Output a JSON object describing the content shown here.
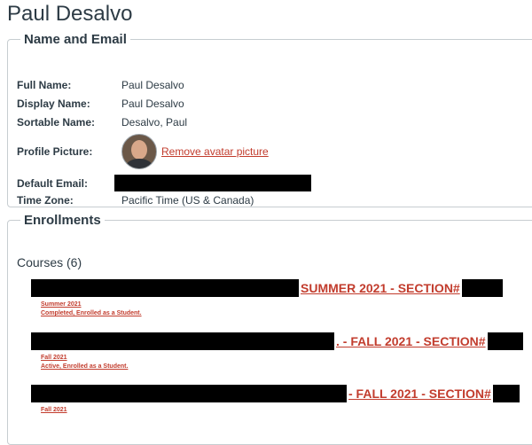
{
  "page_title": "Paul Desalvo",
  "name_email": {
    "legend": "Name and Email",
    "full_name_label": "Full Name:",
    "full_name": "Paul Desalvo",
    "display_name_label": "Display Name:",
    "display_name": "Paul Desalvo",
    "sortable_name_label": "Sortable Name:",
    "sortable_name": "Desalvo, Paul",
    "profile_picture_label": "Profile Picture:",
    "remove_avatar": "Remove avatar picture",
    "default_email_label": "Default Email:",
    "time_zone_label": "Time Zone:",
    "time_zone": "Pacific Time (US & Canada)"
  },
  "enrollments": {
    "legend": "Enrollments",
    "courses_title": "Courses (6)",
    "courses": [
      {
        "name": "SUMMER 2021 - SECTION#",
        "term": "Summer 2021",
        "status": "Completed, Enrolled as a Student."
      },
      {
        "name": ". - FALL 2021 - SECTION#",
        "term": "Fall 2021",
        "status": "Active, Enrolled as a Student."
      },
      {
        "name": "- FALL 2021 - SECTION#",
        "term": "Fall 2021",
        "status": ""
      }
    ]
  },
  "colors": {
    "link": "#c23c2d",
    "text": "#2d3b45",
    "border": "#c7cdd1",
    "redaction": "#000000"
  }
}
